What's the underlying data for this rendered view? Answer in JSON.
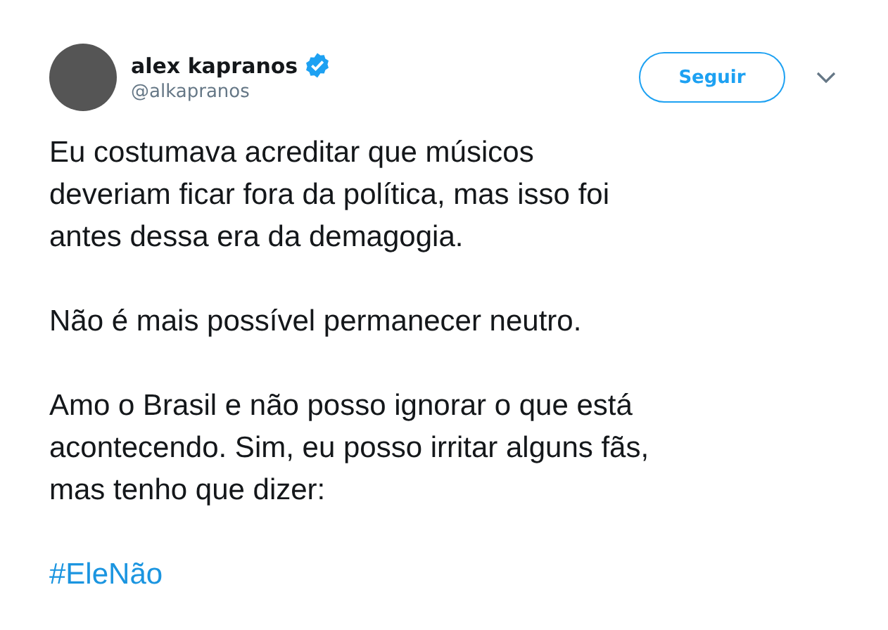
{
  "author": {
    "name": "alex kapranos",
    "verified": true,
    "handle": "@alkapranos"
  },
  "follow_button": {
    "label": "Seguir"
  },
  "paragraphs": [
    {
      "kind": "text",
      "text": "Eu costumava acreditar que músicos\ndeveriam ficar fora da política, mas isso foi\nantes dessa era da demagogia."
    },
    {
      "kind": "text",
      "text": "Não é mais possível permanecer neutro."
    },
    {
      "kind": "text",
      "text": "Amo o Brasil e não posso ignorar o que está\nacontecendo. Sim, eu posso irritar alguns fãs,\nmas tenho que dizer:"
    },
    {
      "kind": "hashtag",
      "text": "#EleNão"
    }
  ]
}
